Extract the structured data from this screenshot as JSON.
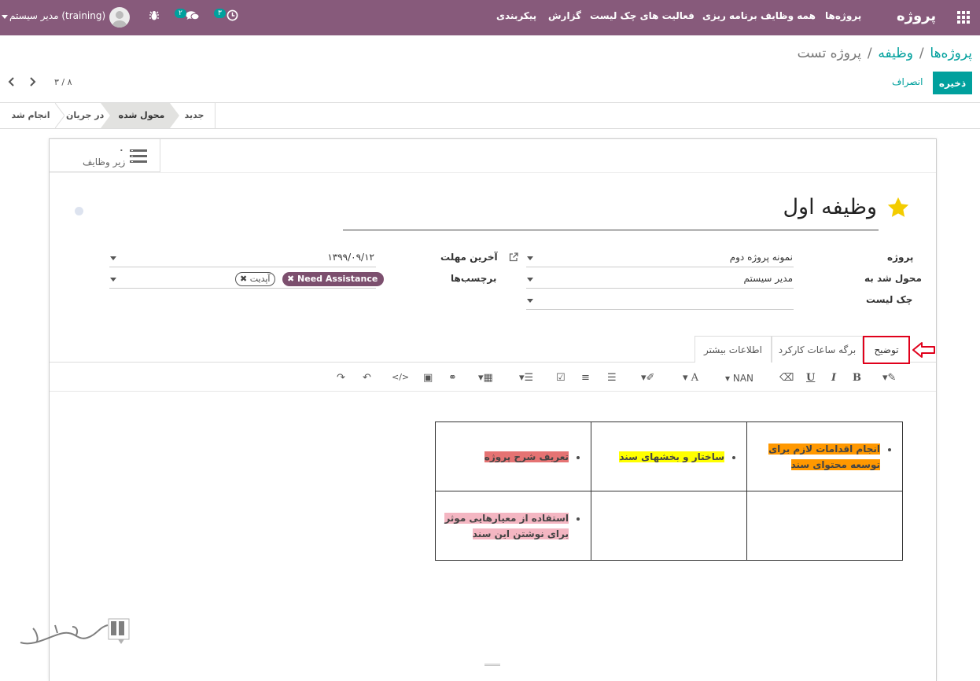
{
  "topbar": {
    "app_name": "پروژه",
    "menu": [
      "پروژه‌ها",
      "همه وظایف",
      "برنامه ریزی",
      "فعالیت های چک لیست",
      "گزارش",
      "پیکربندی"
    ],
    "activity_count": "۳",
    "message_count": "۲",
    "user_label": "مدیر سیستم (training)"
  },
  "breadcrumb": {
    "root": "پروژه‌ها",
    "sep": "/",
    "mid": "وظیفه",
    "current": "پروژه تست"
  },
  "buttons": {
    "save": "ذخیره",
    "discard": "انصراف"
  },
  "pager": {
    "value": "۳ / ۸"
  },
  "stages": [
    "جدید",
    "محول شده",
    "در جریان",
    "انجام شد"
  ],
  "smart_button": {
    "count": "۰",
    "label": "زیر وظایف"
  },
  "task": {
    "title": "وظیفه اول"
  },
  "fields": {
    "project_label": "پروژه",
    "project_value": "نمونه پروژه دوم",
    "assigned_label": "محول شد به",
    "assigned_value": "مدیر سیستم",
    "checklist_label": "چک لیست",
    "checklist_value": "",
    "deadline_label": "آخرین مهلت",
    "deadline_value": "۱۳۹۹/۰۹/۱۲",
    "tags_label": "برچسب‌ها",
    "tags": [
      "Need Assistance",
      "آپدیت"
    ]
  },
  "tabs": [
    "توضیح",
    "برگه ساعات کارکرد",
    "اطلاعات بیشتر"
  ],
  "toolbar": {
    "font_size": "NAN",
    "bold": "B",
    "italic": "I",
    "underline": "U",
    "font_color": "A"
  },
  "description_table": {
    "row1": [
      "تعریف شرح پروژه",
      "ساختار و بخشهای سند",
      "انجام اقدامات لازم برای توسعه محتوای سند"
    ],
    "row2": [
      "استفاده از معیارهایی موثر برای نوشتن این سند",
      "",
      ""
    ]
  },
  "colors": {
    "topbar": "#875a7b",
    "teal": "#00a09d",
    "highlight_box": "#e0001b",
    "star": "#f3cc00"
  }
}
